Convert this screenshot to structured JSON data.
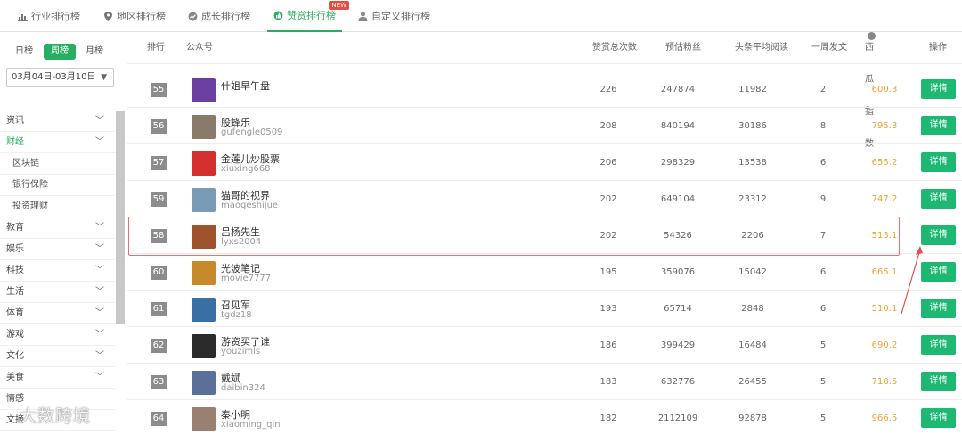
{
  "topnav": {
    "tabs": [
      {
        "label": "行业排行榜",
        "icon": "bar-chart-icon"
      },
      {
        "label": "地区排行榜",
        "icon": "map-pin-icon"
      },
      {
        "label": "成长排行榜",
        "icon": "growth-icon"
      },
      {
        "label": "赞赏排行榜",
        "icon": "thumbs-up-icon",
        "active": true,
        "badge": "NEW"
      },
      {
        "label": "自定义排行榜",
        "icon": "user-icon"
      }
    ]
  },
  "sidebar": {
    "period": {
      "day": "日榜",
      "week": "周榜",
      "month": "月榜",
      "selected": "周榜"
    },
    "date_range": "03月04日-03月10日",
    "categories": [
      {
        "label": "资讯",
        "expandable": true
      },
      {
        "label": "财经",
        "expandable": true,
        "active": true
      },
      {
        "label": "区块链",
        "sub": true
      },
      {
        "label": "银行保险",
        "sub": true
      },
      {
        "label": "投资理财",
        "sub": true
      },
      {
        "label": "教育",
        "expandable": true
      },
      {
        "label": "娱乐",
        "expandable": true
      },
      {
        "label": "科技",
        "expandable": true
      },
      {
        "label": "生活",
        "expandable": true
      },
      {
        "label": "体育",
        "expandable": true
      },
      {
        "label": "游戏",
        "expandable": true
      },
      {
        "label": "文化",
        "expandable": true
      },
      {
        "label": "美食",
        "expandable": true
      },
      {
        "label": "情感",
        "expandable": false
      },
      {
        "label": "文摘",
        "expandable": false
      }
    ]
  },
  "table": {
    "headers": {
      "rank": "排行",
      "account": "公众号",
      "total_reward": "赞赏总次数",
      "fans": "预估粉丝",
      "avg_read": "头条平均阅读",
      "weekly_posts": "一周发文",
      "index": "西瓜指数",
      "action": "操作"
    },
    "rows": [
      {
        "rank": "55",
        "name": "什姐早午盘",
        "id": "",
        "reward": "226",
        "fans": "247874",
        "read": "11982",
        "posts": "2",
        "index": "600.3",
        "action": "详情",
        "avatar": "#6b3fa0"
      },
      {
        "rank": "56",
        "name": "股蜂乐",
        "id": "gufengle0509",
        "reward": "208",
        "fans": "840194",
        "read": "30186",
        "posts": "8",
        "index": "795.3",
        "action": "详情",
        "avatar": "#8a7a6a"
      },
      {
        "rank": "57",
        "name": "金莲儿炒股票",
        "id": "xiuxing668",
        "reward": "206",
        "fans": "298329",
        "read": "13538",
        "posts": "6",
        "index": "655.2",
        "action": "详情",
        "avatar": "#d32f2f"
      },
      {
        "rank": "59",
        "name": "猫哥的视界",
        "id": "maogeshijue",
        "reward": "202",
        "fans": "649104",
        "read": "23312",
        "posts": "9",
        "index": "747.2",
        "action": "详情",
        "avatar": "#7a9bb5"
      },
      {
        "rank": "58",
        "name": "吕杨先生",
        "id": "lyxs2004",
        "reward": "202",
        "fans": "54326",
        "read": "2206",
        "posts": "7",
        "index": "513.1",
        "action": "详情",
        "avatar": "#a0522d"
      },
      {
        "rank": "60",
        "name": "光波笔记",
        "id": "movie7777",
        "reward": "195",
        "fans": "359076",
        "read": "15042",
        "posts": "6",
        "index": "665.1",
        "action": "详情",
        "avatar": "#c68a2a"
      },
      {
        "rank": "61",
        "name": "召见军",
        "id": "tgdz18",
        "reward": "193",
        "fans": "65714",
        "read": "2848",
        "posts": "6",
        "index": "510.1",
        "action": "详情",
        "avatar": "#3a6ea5"
      },
      {
        "rank": "62",
        "name": "游资买了谁",
        "id": "youzimls",
        "reward": "186",
        "fans": "399429",
        "read": "16484",
        "posts": "5",
        "index": "690.2",
        "action": "详情",
        "avatar": "#2a2a2a"
      },
      {
        "rank": "63",
        "name": "戴斌",
        "id": "daibin324",
        "reward": "183",
        "fans": "632776",
        "read": "26455",
        "posts": "5",
        "index": "718.5",
        "action": "详情",
        "avatar": "#5a6f9a"
      },
      {
        "rank": "64",
        "name": "秦小明",
        "id": "xiaoming_qin",
        "reward": "182",
        "fans": "2112109",
        "read": "92878",
        "posts": "5",
        "index": "966.5",
        "action": "详情",
        "avatar": "#9a8070"
      }
    ]
  },
  "watermark": "大数跨境",
  "colors": {
    "accent": "#27ae60",
    "button": "#1fb873",
    "index": "#f0a030",
    "highlight": "#e57373"
  }
}
